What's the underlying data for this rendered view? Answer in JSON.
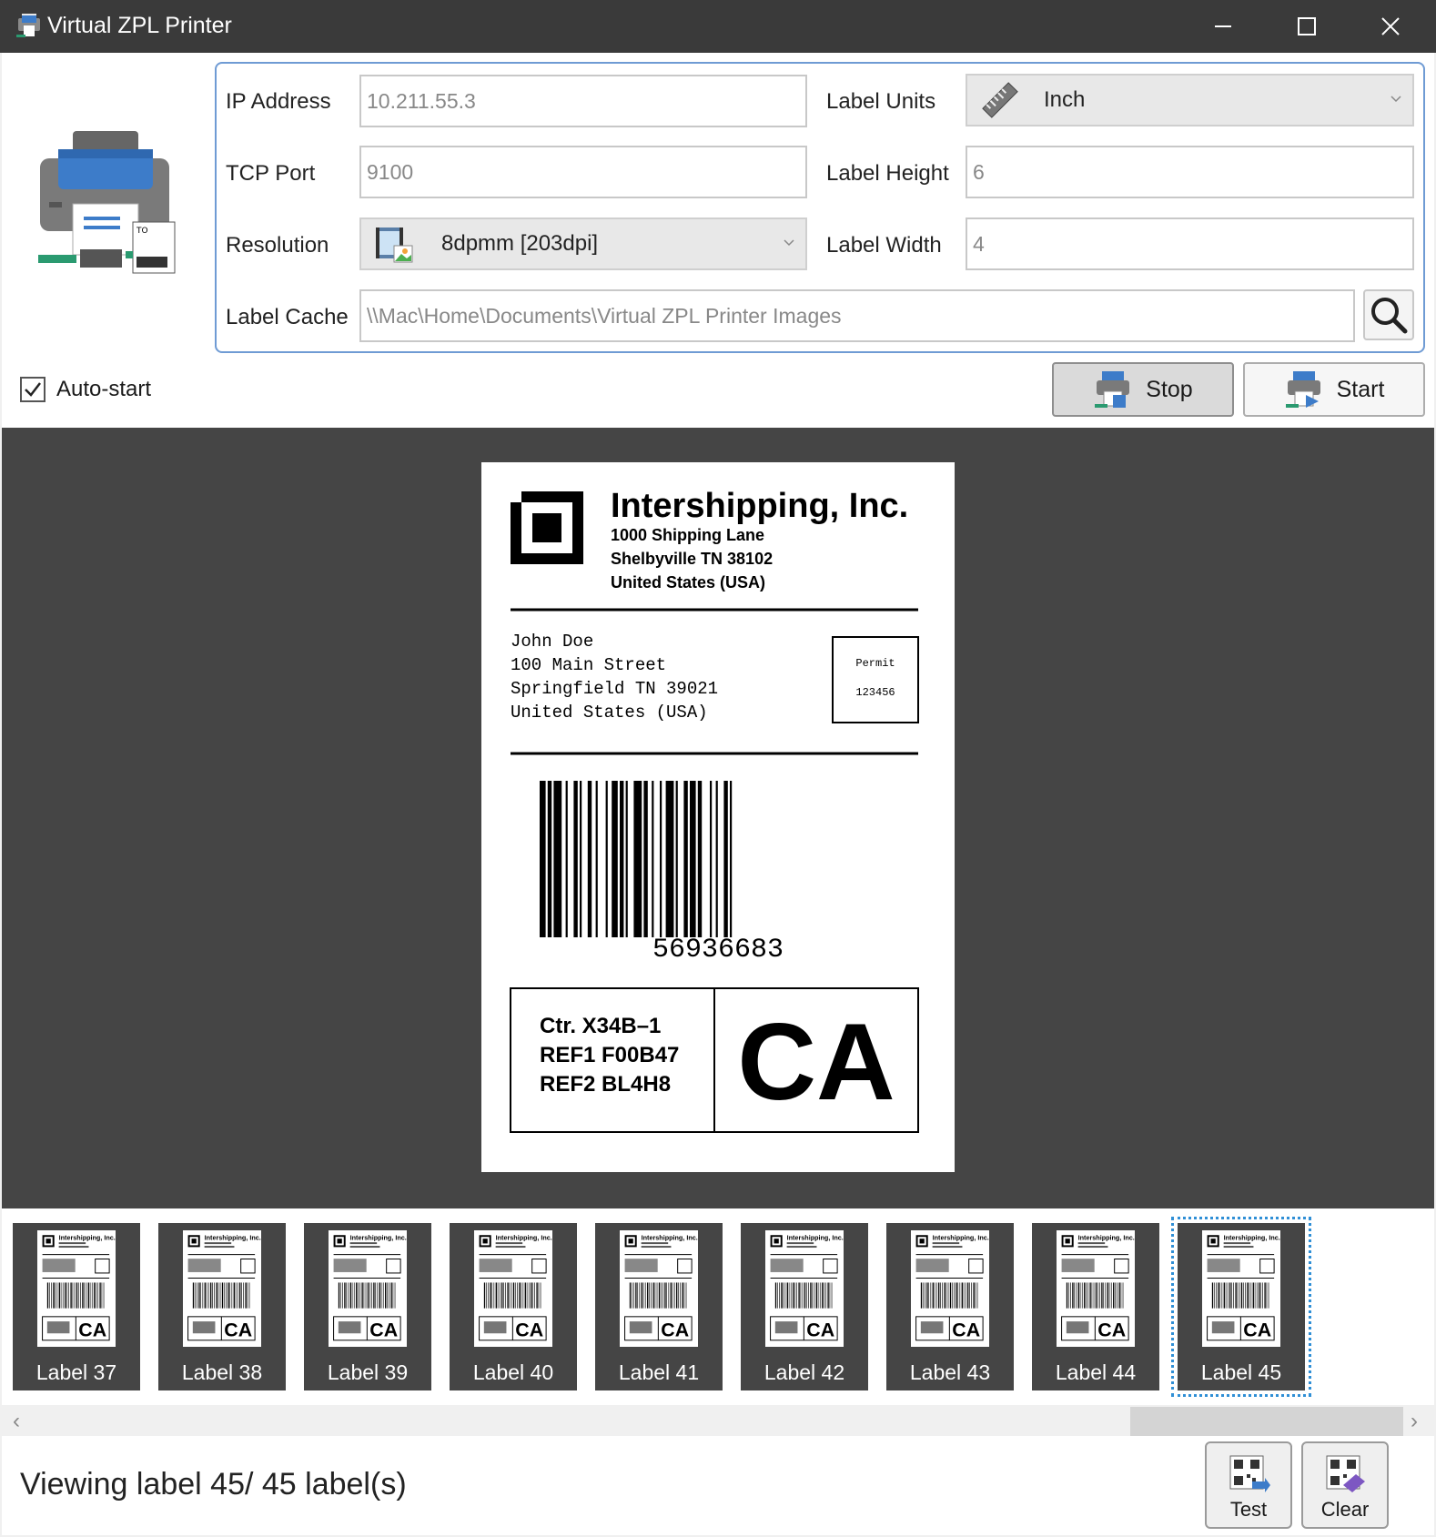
{
  "window": {
    "title": "Virtual ZPL Printer"
  },
  "settings": {
    "ip_label": "IP Address",
    "ip_value": "10.211.55.3",
    "port_label": "TCP Port",
    "port_value": "9100",
    "resolution_label": "Resolution",
    "resolution_value": "8dpmm [203dpi]",
    "cache_label": "Label Cache",
    "cache_value": "\\\\Mac\\Home\\Documents\\Virtual ZPL Printer Images",
    "units_label": "Label Units",
    "units_value": "Inch",
    "height_label": "Label Height",
    "height_value": "6",
    "width_label": "Label Width",
    "width_value": "4"
  },
  "autostart": {
    "label": "Auto-start",
    "checked": true
  },
  "buttons": {
    "stop": "Stop",
    "start": "Start",
    "test": "Test",
    "clear": "Clear"
  },
  "label_preview": {
    "company": "Intershipping, Inc.",
    "company_address": [
      "1000 Shipping Lane",
      "Shelbyville TN 38102",
      "United States (USA)"
    ],
    "recipient": [
      "John Doe",
      "100 Main Street",
      "Springfield TN 39021",
      "United States (USA)"
    ],
    "permit_title": "Permit",
    "permit_number": "123456",
    "barcode_number": "56936683",
    "refs": [
      "Ctr. X34B–1",
      "REF1 F00B47",
      "REF2 BL4H8"
    ],
    "state_code": "CA"
  },
  "thumbnails": [
    {
      "label": "Label 37",
      "selected": false
    },
    {
      "label": "Label 38",
      "selected": false
    },
    {
      "label": "Label 39",
      "selected": false
    },
    {
      "label": "Label 40",
      "selected": false
    },
    {
      "label": "Label 41",
      "selected": false
    },
    {
      "label": "Label 42",
      "selected": false
    },
    {
      "label": "Label 43",
      "selected": false
    },
    {
      "label": "Label 44",
      "selected": false
    },
    {
      "label": "Label 45",
      "selected": true
    }
  ],
  "thumb_mini": {
    "company": "Intershipping, Inc.",
    "state_code": "CA"
  },
  "status": {
    "text": "Viewing label 45/ 45 label(s)"
  },
  "colors": {
    "titlebar": "#3a3a3a",
    "accent_border": "#6f9bd4",
    "preview_bg": "#454545",
    "selection": "#2f8fd6"
  }
}
